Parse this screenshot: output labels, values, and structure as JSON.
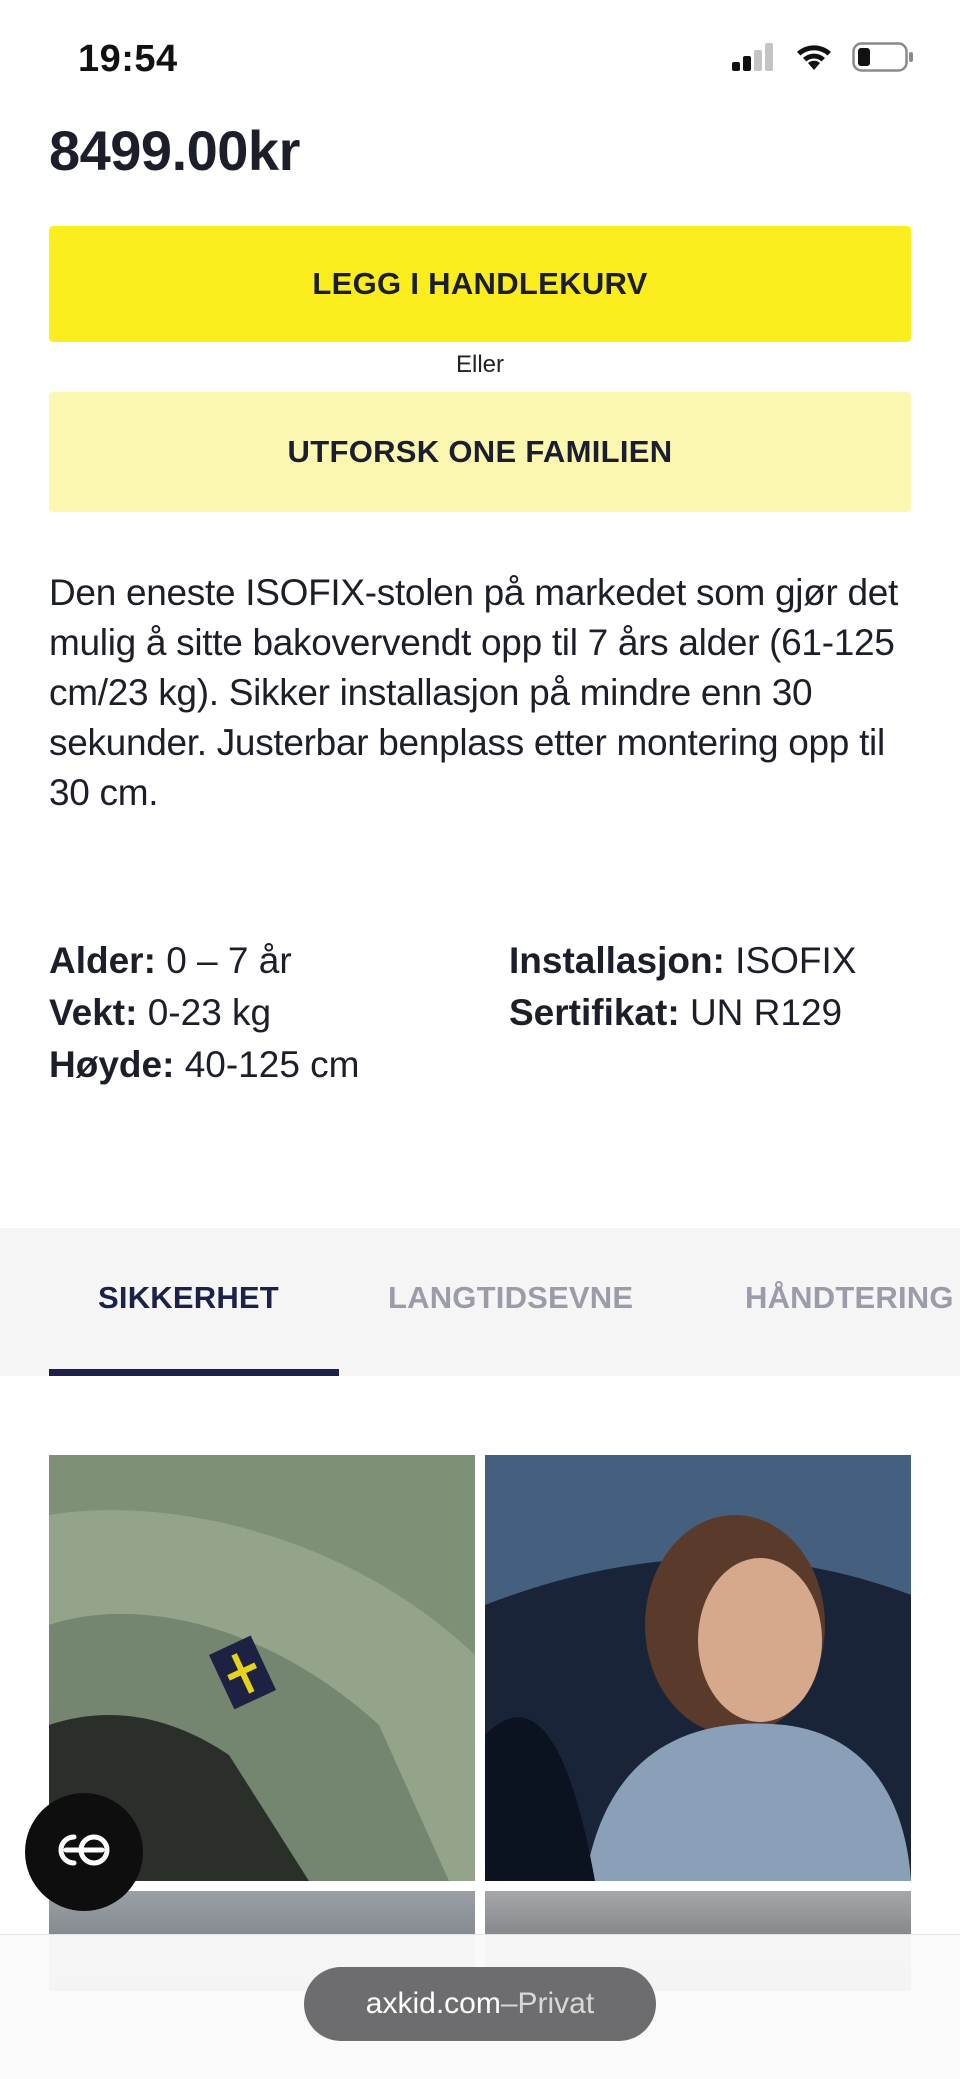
{
  "status_bar": {
    "time": "19:54"
  },
  "product": {
    "price": "8499.00kr",
    "add_to_cart_label": "LEGG I HANDLEKURV",
    "or_label": "Eller",
    "explore_label": "UTFORSK ONE FAMILIEN",
    "description": "Den eneste ISOFIX-stolen på markedet som gjør det mulig å sitte bakovervendt opp til 7 års alder (61-125 cm/23 kg). Sikker installasjon på mindre enn 30 sekunder. Justerbar benplass etter montering opp til 30 cm."
  },
  "specs": {
    "left": [
      {
        "label": "Alder:",
        "value": "0 – 7 år"
      },
      {
        "label": "Vekt:",
        "value": "0-23 kg"
      },
      {
        "label": "Høyde:",
        "value": "40-125 cm"
      }
    ],
    "right": [
      {
        "label": "Installasjon:",
        "value": "ISOFIX"
      },
      {
        "label": "Sertifikat:",
        "value": "UN R129"
      }
    ]
  },
  "tabs": [
    {
      "label": "SIKKERHET",
      "active": true
    },
    {
      "label": "LANGTIDSEVNE",
      "active": false
    },
    {
      "label": "HÅNDTERING",
      "active": false
    }
  ],
  "browser": {
    "domain": "axkid.com",
    "separator": " – ",
    "mode": "Privat"
  },
  "colors": {
    "primary_yellow": "#fcee1e",
    "light_yellow": "#fbf7b0",
    "navy": "#1c2147",
    "muted_tab": "#9a9caa"
  },
  "icons": {
    "signal": "cellular-signal-icon",
    "wifi": "wifi-icon",
    "battery": "battery-icon",
    "chat": "chat-icon"
  }
}
